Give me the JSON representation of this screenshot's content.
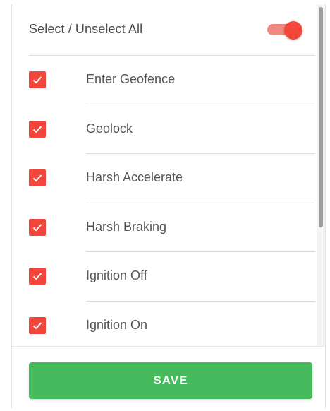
{
  "header": {
    "select_all_label": "Select / Unselect All",
    "toggle_on": true
  },
  "items": [
    {
      "label": "Enter Geofence",
      "checked": true
    },
    {
      "label": "Geolock",
      "checked": true
    },
    {
      "label": "Harsh Accelerate",
      "checked": true
    },
    {
      "label": "Harsh Braking",
      "checked": true
    },
    {
      "label": "Ignition Off",
      "checked": true
    },
    {
      "label": "Ignition On",
      "checked": true
    }
  ],
  "footer": {
    "save_label": "SAVE"
  },
  "colors": {
    "accent_red": "#f2453b",
    "toggle_track": "#f08a80",
    "save_green": "#45bb5e"
  },
  "icons": {
    "checkbox": "check-icon"
  }
}
